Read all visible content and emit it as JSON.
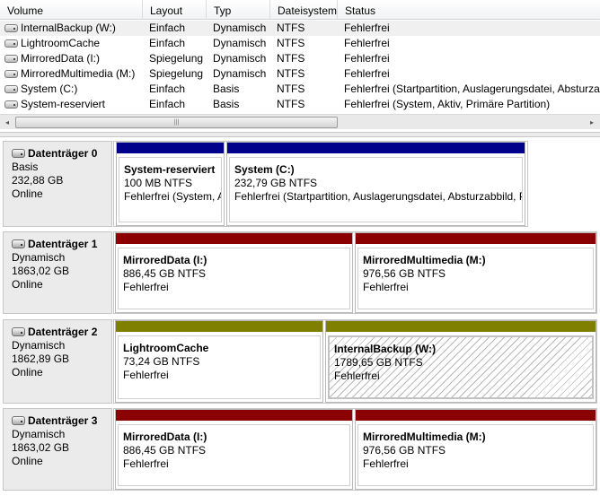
{
  "volume_list": {
    "columns": [
      "Volume",
      "Layout",
      "Typ",
      "Dateisystem",
      "Status"
    ],
    "rows": [
      {
        "volume": "InternalBackup (W:)",
        "layout": "Einfach",
        "typ": "Dynamisch",
        "dateisystem": "NTFS",
        "status": "Fehlerfrei"
      },
      {
        "volume": "LightroomCache",
        "layout": "Einfach",
        "typ": "Dynamisch",
        "dateisystem": "NTFS",
        "status": "Fehlerfrei"
      },
      {
        "volume": "MirroredData (I:)",
        "layout": "Spiegelung",
        "typ": "Dynamisch",
        "dateisystem": "NTFS",
        "status": "Fehlerfrei"
      },
      {
        "volume": "MirroredMultimedia (M:)",
        "layout": "Spiegelung",
        "typ": "Dynamisch",
        "dateisystem": "NTFS",
        "status": "Fehlerfrei"
      },
      {
        "volume": "System (C:)",
        "layout": "Einfach",
        "typ": "Basis",
        "dateisystem": "NTFS",
        "status": "Fehlerfrei (Startpartition, Auslagerungsdatei, Absturzabbild, Primäre Partition)"
      },
      {
        "volume": "System-reserviert",
        "layout": "Einfach",
        "typ": "Basis",
        "dateisystem": "NTFS",
        "status": "Fehlerfrei (System, Aktiv, Primäre Partition)"
      }
    ],
    "selected_row": 0,
    "scrollbar": {
      "left_arrow": "◂",
      "right_arrow": "▸",
      "thumb_grip": "|||"
    }
  },
  "colors": {
    "basic_primary": "#00008b",
    "mirrored": "#8b0000",
    "simple_dynamic": "#808000"
  },
  "disks": [
    {
      "name": "Datenträger 0",
      "type": "Basis",
      "size": "232,88 GB",
      "status": "Online",
      "partitions": [
        {
          "name": "System-reserviert",
          "size": "100 MB NTFS",
          "status": "Fehlerfrei (System, Aktiv, Primäre Partition)",
          "color": "#00008b"
        },
        {
          "name": "System  (C:)",
          "size": "232,79 GB NTFS",
          "status": "Fehlerfrei (Startpartition, Auslagerungsdatei, Absturzabbild, Primäre Partition)",
          "color": "#00008b"
        }
      ]
    },
    {
      "name": "Datenträger 1",
      "type": "Dynamisch",
      "size": "1863,02 GB",
      "status": "Online",
      "partitions": [
        {
          "name": "MirroredData  (I:)",
          "size": "886,45 GB NTFS",
          "status": "Fehlerfrei",
          "color": "#8b0000"
        },
        {
          "name": "MirroredMultimedia  (M:)",
          "size": "976,56 GB NTFS",
          "status": "Fehlerfrei",
          "color": "#8b0000"
        }
      ]
    },
    {
      "name": "Datenträger 2",
      "type": "Dynamisch",
      "size": "1862,89 GB",
      "status": "Online",
      "partitions": [
        {
          "name": "LightroomCache",
          "size": "73,24 GB NTFS",
          "status": "Fehlerfrei",
          "color": "#808000"
        },
        {
          "name": "InternalBackup  (W:)",
          "size": "1789,65 GB NTFS",
          "status": "Fehlerfrei",
          "color": "#808000",
          "selected": true
        }
      ]
    },
    {
      "name": "Datenträger 3",
      "type": "Dynamisch",
      "size": "1863,02 GB",
      "status": "Online",
      "partitions": [
        {
          "name": "MirroredData  (I:)",
          "size": "886,45 GB NTFS",
          "status": "Fehlerfrei",
          "color": "#8b0000"
        },
        {
          "name": "MirroredMultimedia  (M:)",
          "size": "976,56 GB NTFS",
          "status": "Fehlerfrei",
          "color": "#8b0000"
        }
      ]
    }
  ]
}
